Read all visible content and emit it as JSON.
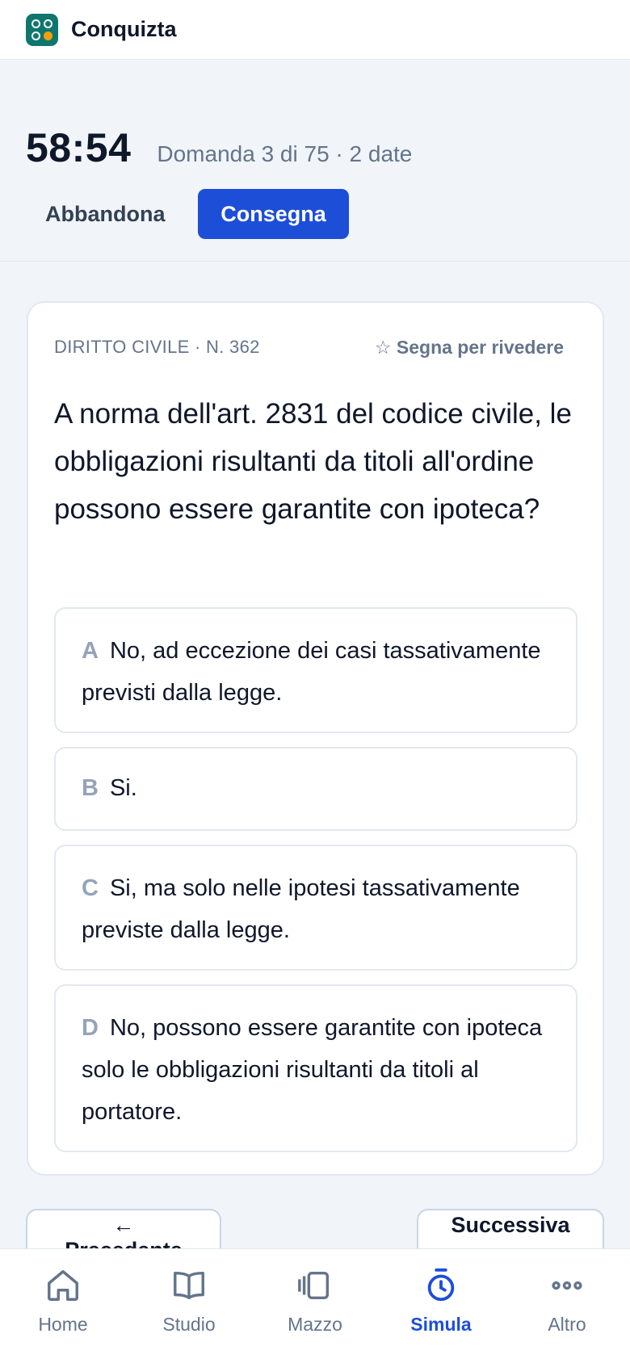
{
  "app": {
    "name": "Conquizta"
  },
  "exam": {
    "timer": "58:54",
    "progress": "Domanda 3 di 75 · 2 date",
    "abandon_label": "Abbandona",
    "submit_label": "Consegna"
  },
  "question": {
    "meta": "DIRITTO CIVILE · N. 362",
    "mark_review_label": "☆ Segna per rivedere",
    "text": "A norma dell'art. 2831 del codice civile, le obbligazioni risultanti da titoli all'ordine possono essere garantite con ipoteca?",
    "options": [
      {
        "letter": "A",
        "text": "No, ad eccezione dei casi tassativamente previsti dalla legge."
      },
      {
        "letter": "B",
        "text": "Si."
      },
      {
        "letter": "C",
        "text": "Si, ma solo nelle ipotesi tassativamente previste dalla legge."
      },
      {
        "letter": "D",
        "text": "No, possono essere garantite con ipoteca solo le obbligazioni risultanti da titoli al portatore."
      }
    ]
  },
  "navigation": {
    "previous_label": "← Precedente",
    "next_label": "Successiva →"
  },
  "bottom_nav": {
    "items": [
      {
        "label": "Home",
        "icon": "home-icon",
        "active": false
      },
      {
        "label": "Studio",
        "icon": "book-icon",
        "active": false
      },
      {
        "label": "Mazzo",
        "icon": "cards-icon",
        "active": false
      },
      {
        "label": "Simula",
        "icon": "timer-icon",
        "active": true
      },
      {
        "label": "Altro",
        "icon": "more-icon",
        "active": false
      }
    ]
  },
  "colors": {
    "accent": "#1d4ed8",
    "brand": "#0f766e",
    "brand_dot": "#f59e0b",
    "background": "#f1f5f9",
    "muted_text": "#64748b"
  }
}
